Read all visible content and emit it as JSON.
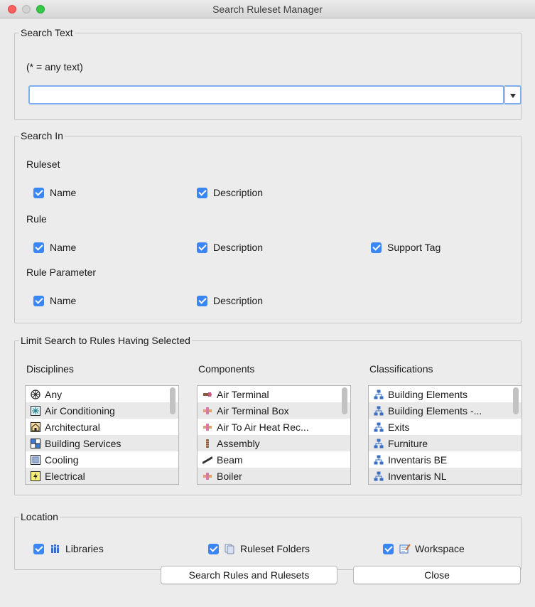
{
  "window": {
    "title": "Search Ruleset Manager"
  },
  "search_text": {
    "legend": "Search Text",
    "hint": "(* = any text)",
    "value": "",
    "placeholder": ""
  },
  "search_in": {
    "legend": "Search In",
    "ruleset": {
      "heading": "Ruleset",
      "name": "Name",
      "description": "Description"
    },
    "rule": {
      "heading": "Rule",
      "name": "Name",
      "description": "Description",
      "support_tag": "Support Tag"
    },
    "rule_parameter": {
      "heading": "Rule Parameter",
      "name": "Name",
      "description": "Description"
    }
  },
  "limit": {
    "legend": "Limit Search to Rules Having Selected",
    "disciplines": {
      "heading": "Disciplines",
      "items": [
        {
          "label": "Any",
          "icon": "any-icon"
        },
        {
          "label": "Air Conditioning",
          "icon": "air-conditioning-icon"
        },
        {
          "label": "Architectural",
          "icon": "architectural-icon"
        },
        {
          "label": "Building Services",
          "icon": "building-services-icon"
        },
        {
          "label": "Cooling",
          "icon": "cooling-icon"
        },
        {
          "label": "Electrical",
          "icon": "electrical-icon"
        }
      ]
    },
    "components": {
      "heading": "Components",
      "items": [
        {
          "label": "Air Terminal",
          "icon": "air-terminal-icon"
        },
        {
          "label": "Air Terminal Box",
          "icon": "air-terminal-box-icon"
        },
        {
          "label": "Air To Air Heat Rec...",
          "icon": "heat-recovery-icon"
        },
        {
          "label": "Assembly",
          "icon": "assembly-icon"
        },
        {
          "label": "Beam",
          "icon": "beam-icon"
        },
        {
          "label": "Boiler",
          "icon": "boiler-icon"
        }
      ]
    },
    "classifications": {
      "heading": "Classifications",
      "items": [
        {
          "label": "Building Elements",
          "icon": "classification-tree-icon"
        },
        {
          "label": "Building Elements -...",
          "icon": "classification-tree-icon"
        },
        {
          "label": "Exits",
          "icon": "classification-tree-icon"
        },
        {
          "label": "Furniture",
          "icon": "classification-tree-icon"
        },
        {
          "label": "Inventaris BE",
          "icon": "classification-tree-icon"
        },
        {
          "label": "Inventaris NL",
          "icon": "classification-tree-icon"
        }
      ]
    }
  },
  "location": {
    "legend": "Location",
    "libraries": "Libraries",
    "ruleset_folders": "Ruleset Folders",
    "workspace": "Workspace"
  },
  "buttons": {
    "search": "Search Rules and Rulesets",
    "close": "Close"
  },
  "colors": {
    "checkbox_accent": "#3a86f5",
    "focus_ring": "#7eaef0",
    "window_bg": "#ececec"
  }
}
